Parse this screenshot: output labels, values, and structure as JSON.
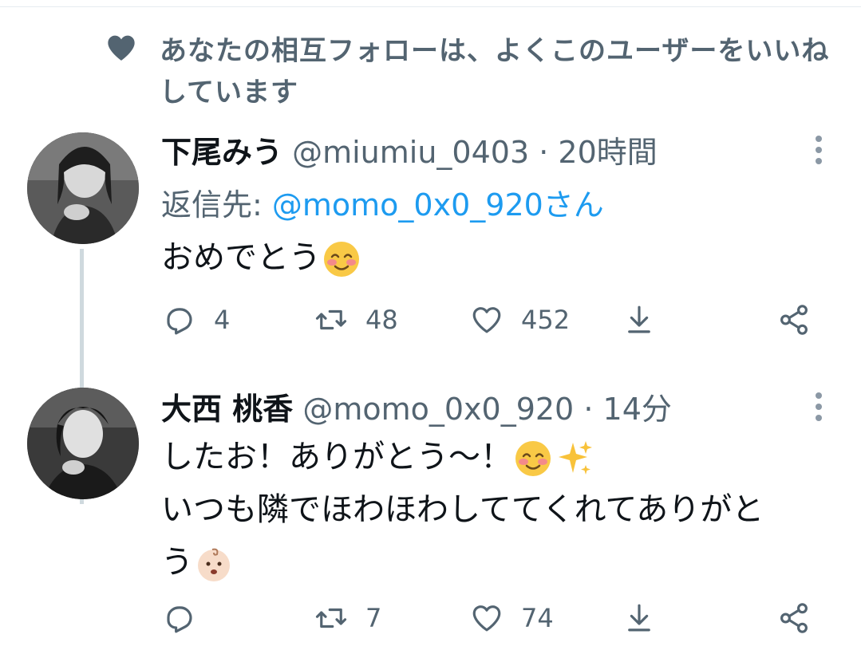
{
  "social_context": {
    "text": "あなたの相互フォローは、よくこのユーザーをいいねしています",
    "icon": "heart-icon"
  },
  "tweets": [
    {
      "display_name": "下尾みう",
      "handle": "@miumiu_0403",
      "separator": "·",
      "time": "20時間",
      "reply_prefix": "返信先: ",
      "reply_mention": "@momo_0x0_920さん",
      "body_text": "おめでとう",
      "body_emoji": "smiling-face-with-blush",
      "reply_count": "4",
      "retweet_count": "48",
      "like_count": "452",
      "share_count": "",
      "avatar": "avatar"
    },
    {
      "display_name": "大西 桃香",
      "handle": "@momo_0x0_920",
      "separator": "·",
      "time": "14分",
      "line1": "したお！ありがとう〜！",
      "line2": "いつも隣でほわほわしててくれてありがと",
      "line3": "う",
      "emoji1": "smiling-face-with-blush",
      "emoji2": "sparkles",
      "emoji3": "baby-face",
      "reply_count": "",
      "retweet_count": "7",
      "like_count": "74",
      "avatar": "avatar"
    }
  ],
  "colors": {
    "text_primary": "#0f1419",
    "text_secondary": "#536471",
    "link": "#1d9bf0",
    "thread_line": "#cfd9de"
  }
}
